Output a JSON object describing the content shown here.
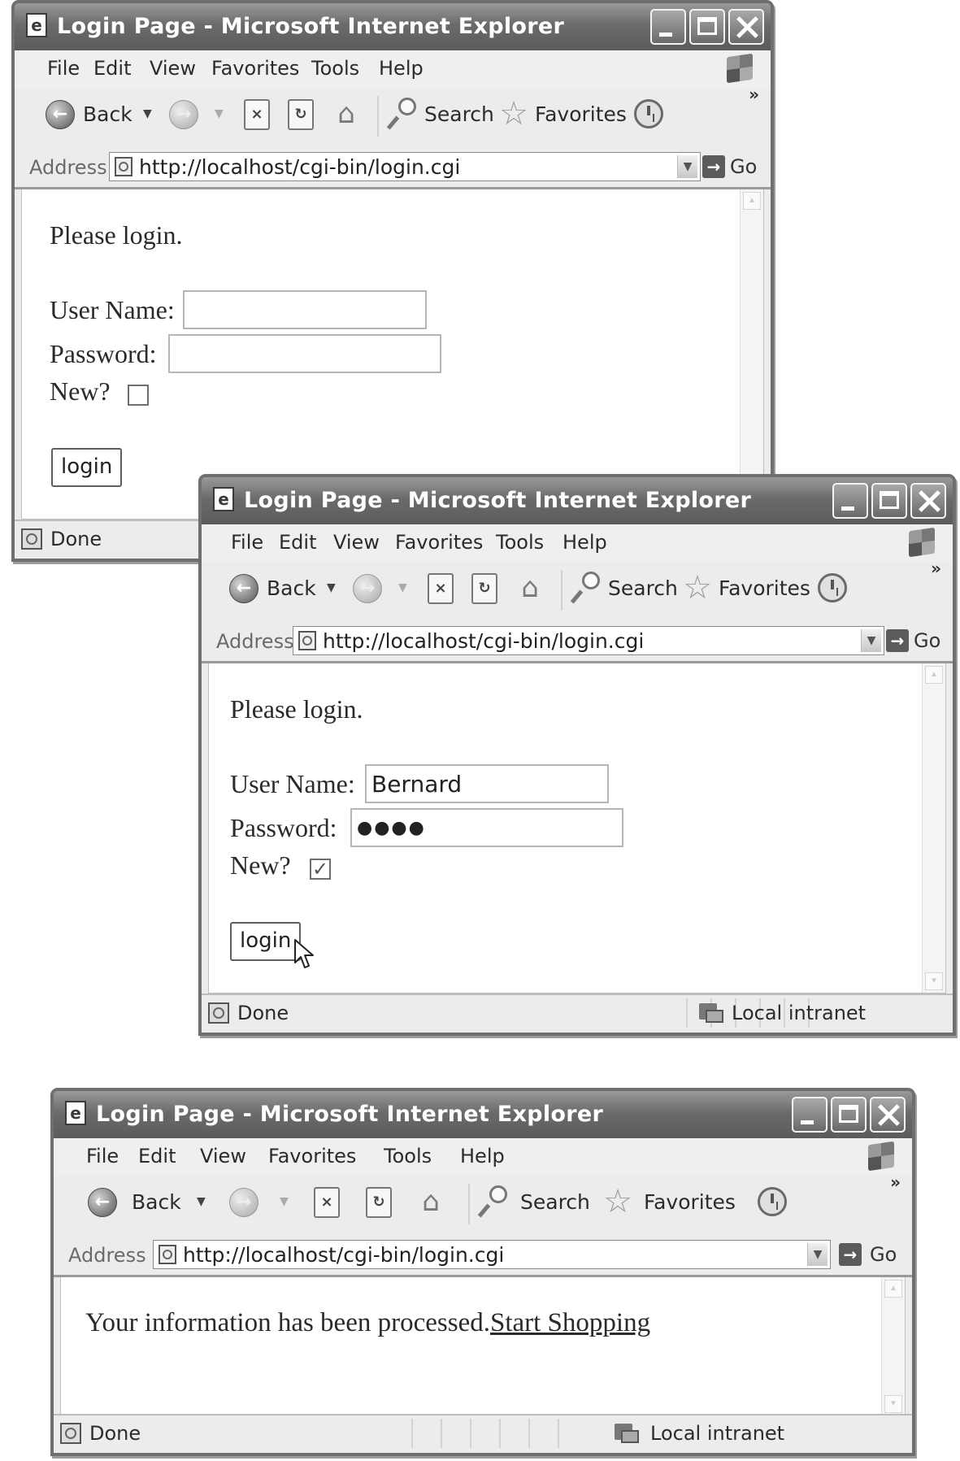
{
  "window_title": "Login Page - Microsoft Internet Explorer",
  "menu": [
    "File",
    "Edit",
    "View",
    "Favorites",
    "Tools",
    "Help"
  ],
  "toolbar": {
    "back_label": "Back",
    "search_label": "Search",
    "favorites_label": "Favorites",
    "more_chevron": "»"
  },
  "address": {
    "label": "Address",
    "url": "http://localhost/cgi-bin/login.cgi",
    "go_label": "Go"
  },
  "login_form": {
    "prompt": "Please login.",
    "username_label": "User Name:",
    "password_label": "Password:",
    "new_label": "New?",
    "submit_label": "login"
  },
  "window1": {
    "username_value": "",
    "password_value": "",
    "new_checked": false,
    "status": "Done"
  },
  "window2": {
    "username_value": "Bernard",
    "password_value": "●●●●",
    "new_checked": true,
    "check_mark": "✓",
    "status": "Done",
    "zone": "Local intranet"
  },
  "window3": {
    "message": "Your information has been processed.",
    "link_text": "Start Shopping",
    "status": "Done",
    "zone": "Local intranet"
  },
  "icons": {
    "back": "back-arrow-icon",
    "forward": "forward-arrow-icon",
    "stop": "stop-icon",
    "refresh": "refresh-icon",
    "home": "home-icon",
    "search": "search-icon",
    "favorites": "favorites-star-icon",
    "history": "history-icon",
    "page": "page-icon",
    "go": "go-arrow-icon",
    "zone": "local-intranet-icon"
  }
}
